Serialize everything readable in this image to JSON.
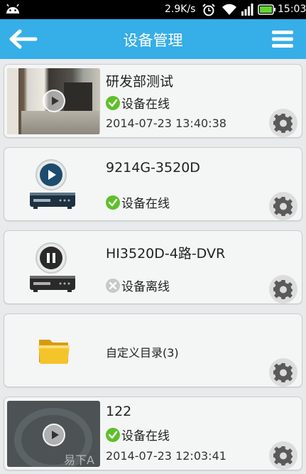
{
  "status_bar": {
    "speed": "2.9K/s",
    "clock": "15:03"
  },
  "header": {
    "title": "设备管理"
  },
  "devices": [
    {
      "name": "研发部测试",
      "status": "设备在线",
      "time": "2014-07-23 13:40:38",
      "state": "online"
    },
    {
      "name": "9214G-3520D",
      "status": "设备在线",
      "state": "online"
    },
    {
      "name": "HI3520D-4路-DVR",
      "status": "设备离线",
      "state": "offline"
    },
    {
      "name": "自定义目录(3)"
    },
    {
      "name": "122",
      "status": "设备在线",
      "time": "2014-07-23 12:03:41",
      "state": "online"
    }
  ],
  "watermark": "易下A",
  "colors": {
    "header": "#36aee8",
    "online": "#5fbf2a",
    "offline": "#c8c8c8"
  }
}
